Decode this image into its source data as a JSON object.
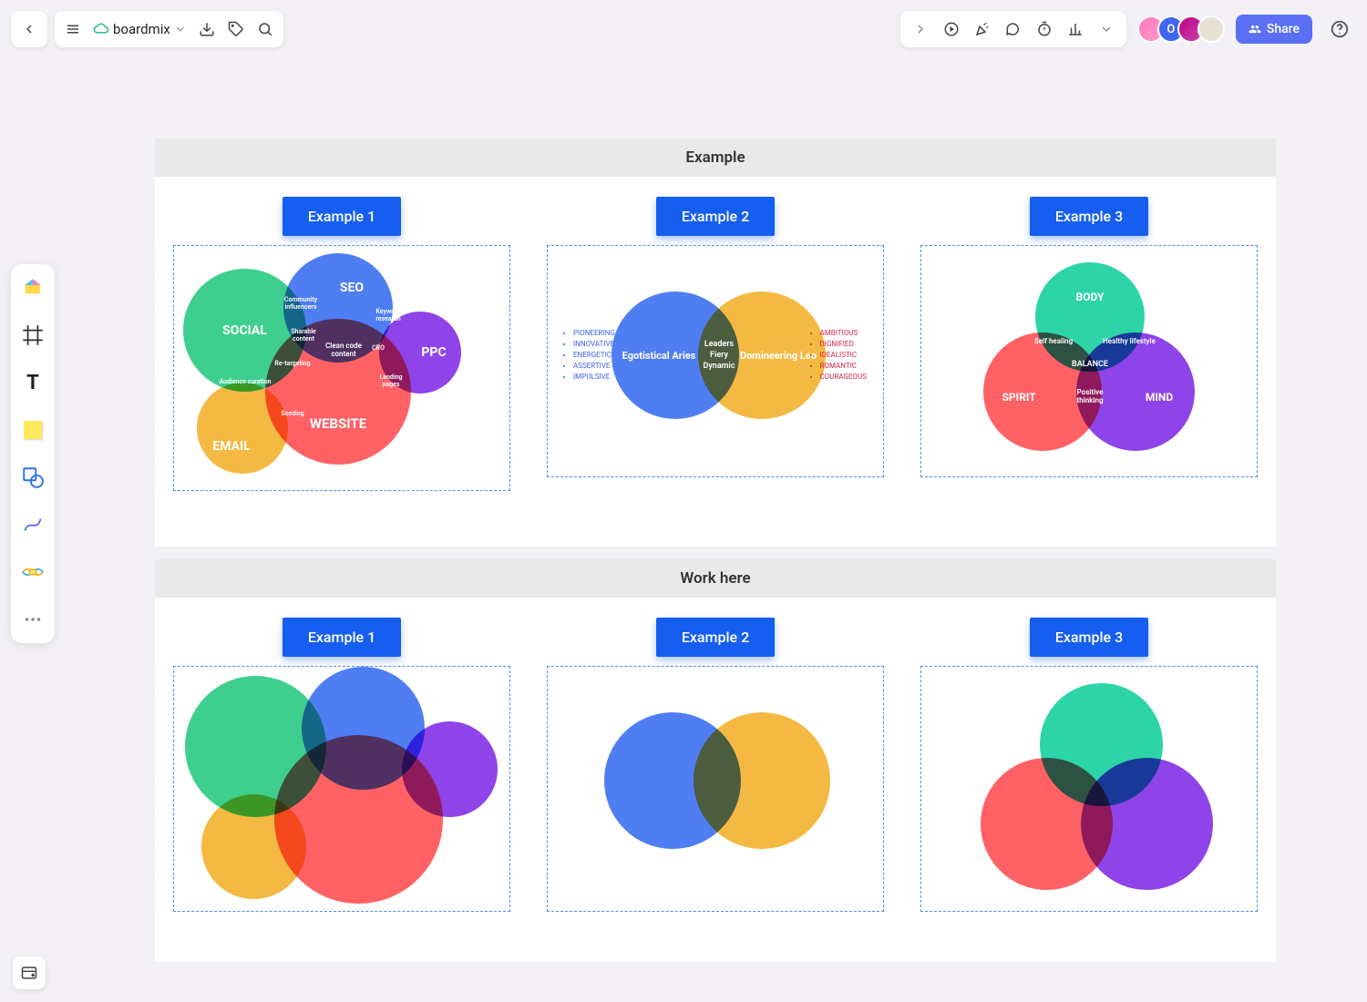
{
  "app": {
    "title": "boardmix",
    "share_label": "Share"
  },
  "sections": {
    "example": "Example",
    "work": "Work here"
  },
  "examples": {
    "e1": "Example 1",
    "e2": "Example 2",
    "e3": "Example 3"
  },
  "venn1": {
    "social": "SOCIAL",
    "seo": "SEO",
    "ppc": "PPC",
    "email": "EMAIL",
    "website": "WEBSITE",
    "community_influencers": "Community influencers",
    "sharable_content": "Sharable content",
    "keyword_research": "Keyword research",
    "cro": "CRO",
    "landing_pages": "Landing pages",
    "clean_code_content": "Clean code content",
    "audience_curation": "Audience curation",
    "retargeting": "Re-targeting",
    "seeding": "Seeding"
  },
  "venn2": {
    "left_label": "Egotistical Aries",
    "right_label": "Domineering Leo",
    "center1": "Leaders",
    "center2": "Fiery",
    "center3": "Dynamic",
    "left_list": [
      "PIONEERING",
      "INNOVATIVE",
      "ENERGETIC",
      "ASSERTIVE",
      "IMPULSIVE"
    ],
    "right_list": [
      "AMBITIOUS",
      "DIGNIFIED",
      "IDEALISTIC",
      "ROMANTIC",
      "COURAGEOUS"
    ]
  },
  "venn3": {
    "body": "BODY",
    "spirit": "SPIRIT",
    "mind": "MIND",
    "balance": "BALANCE",
    "self_healing": "Self healing",
    "healthy_lifestyle": "Healthy lifestyle",
    "positive_thinking": "Positive thinking"
  }
}
